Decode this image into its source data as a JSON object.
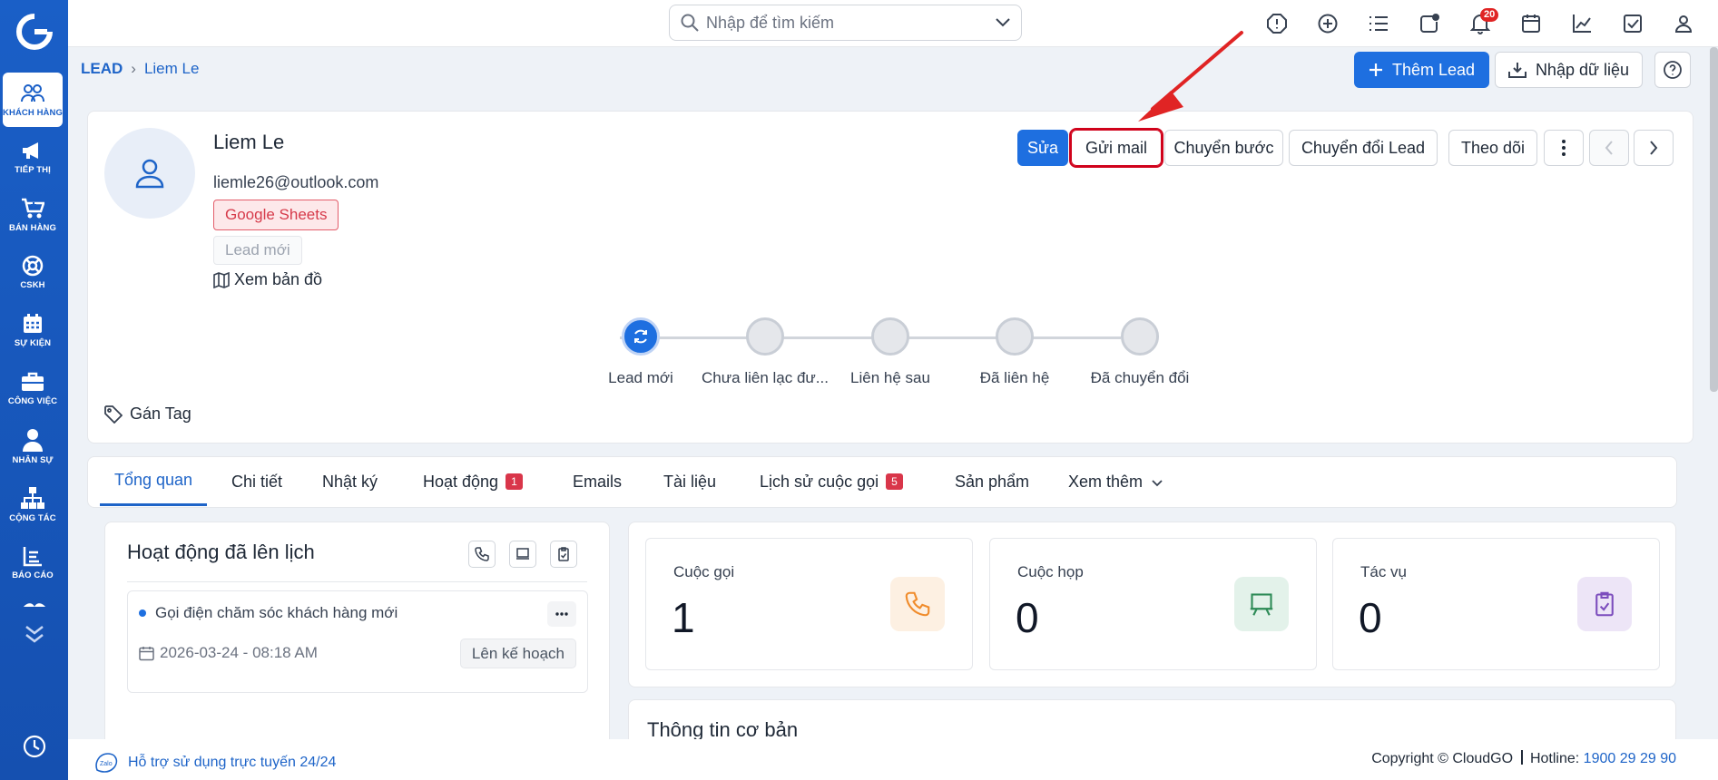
{
  "sidebar": {
    "logo": "cloudgo-logo",
    "items": [
      {
        "label": "Khách hàng",
        "icon": "users-icon"
      },
      {
        "label": "Tiếp thị",
        "icon": "megaphone-icon"
      },
      {
        "label": "Bán hàng",
        "icon": "cart-icon"
      },
      {
        "label": "CSKH",
        "icon": "lifebuoy-icon"
      },
      {
        "label": "Sự kiện",
        "icon": "calendar-icon"
      },
      {
        "label": "Công việc",
        "icon": "briefcase-icon"
      },
      {
        "label": "Nhân sự",
        "icon": "person-icon"
      },
      {
        "label": "Cộng tác",
        "icon": "org-chart-icon"
      },
      {
        "label": "Báo cáo",
        "icon": "report-icon"
      }
    ]
  },
  "topbar": {
    "search_placeholder": "Nhập để tìm kiếm",
    "notification_count": "20"
  },
  "breadcrumb": {
    "root": "LEAD",
    "current": "Liem Le"
  },
  "header_actions": {
    "add_lead": "Thêm Lead",
    "import": "Nhập dữ liệu"
  },
  "lead": {
    "name": "Liem Le",
    "email": "liemle26@outlook.com",
    "source_tag": "Google Sheets",
    "status_tag": "Lead mới",
    "map_link": "Xem bản đồ",
    "assign_tag": "Gán Tag"
  },
  "actions": {
    "edit": "Sửa",
    "send_mail": "Gửi mail",
    "change_step": "Chuyển bước",
    "convert": "Chuyển đổi Lead",
    "follow": "Theo dõi"
  },
  "pipeline": [
    {
      "label": "Lead mới",
      "active": true
    },
    {
      "label": "Chưa liên lạc đư...",
      "active": false
    },
    {
      "label": "Liên hệ sau",
      "active": false
    },
    {
      "label": "Đã liên hệ",
      "active": false
    },
    {
      "label": "Đã chuyển đổi",
      "active": false
    }
  ],
  "tabs": [
    {
      "label": "Tổng quan",
      "count": ""
    },
    {
      "label": "Chi tiết",
      "count": ""
    },
    {
      "label": "Nhật ký",
      "count": ""
    },
    {
      "label": "Hoạt động",
      "count": "1"
    },
    {
      "label": "Emails",
      "count": ""
    },
    {
      "label": "Tài liệu",
      "count": ""
    },
    {
      "label": "Lịch sử cuộc gọi",
      "count": "5"
    },
    {
      "label": "Sản phẩm",
      "count": ""
    },
    {
      "label": "Xem thêm",
      "count": ""
    }
  ],
  "scheduled": {
    "title": "Hoạt động đã lên lịch",
    "activity": {
      "title": "Gọi điện chăm sóc khách hàng mới",
      "datetime": "2026-03-24 - 08:18 AM",
      "plan_button": "Lên kế hoạch"
    }
  },
  "stats": [
    {
      "label": "Cuộc gọi",
      "value": "1",
      "icon": "phone-icon",
      "color": "#f08c2c"
    },
    {
      "label": "Cuộc họp",
      "value": "0",
      "icon": "presentation-icon",
      "color": "#2e8b57"
    },
    {
      "label": "Tác vụ",
      "value": "0",
      "icon": "clipboard-check-icon",
      "color": "#7c4dbd"
    }
  ],
  "basic_info": {
    "title": "Thông tin cơ bản"
  },
  "footer": {
    "support": "Hỗ trợ sử dụng trực tuyến 24/24",
    "copyright": "Copyright © CloudGO",
    "hotline_label": "Hotline:",
    "hotline": "1900 29 29 90"
  },
  "colors": {
    "primary": "#1e6fe0",
    "sidebar": "#1a5fc7",
    "highlight": "#d0021b"
  }
}
